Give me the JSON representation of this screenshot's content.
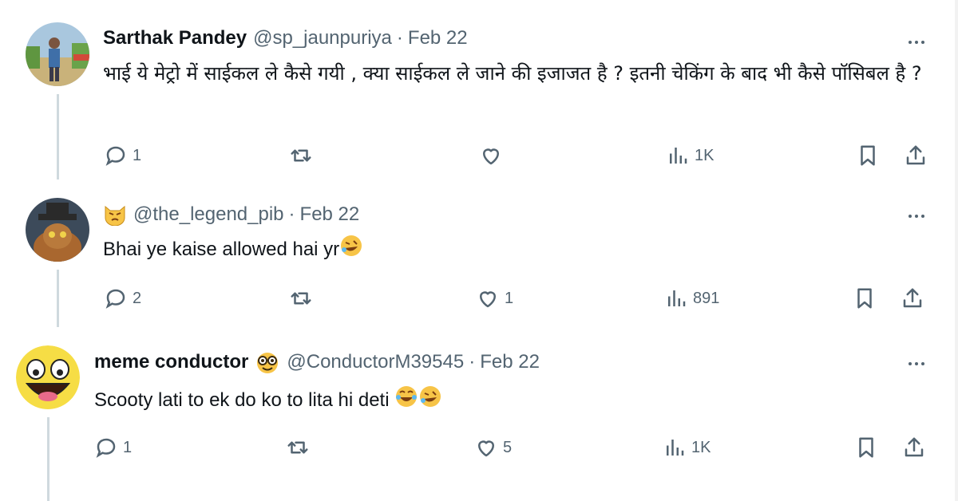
{
  "tweets": [
    {
      "name": "Sarthak Pandey",
      "handle": "@sp_jaunpuriya",
      "sep": "·",
      "date": "Feb 22",
      "text": "भाई ये मेट्रो में साईकल ले कैसे गयी , क्या साईकल ले जाने की इजाजत है ? इतनी चेकिंग के बाद भी कैसे पॉसिबल है ?",
      "replies": "1",
      "retweets": "",
      "likes": "",
      "views": "1K"
    },
    {
      "name": "",
      "handle": "@the_legend_pib",
      "sep": "·",
      "date": "Feb 22",
      "text": "Bhai ye kaise allowed hai yr",
      "replies": "2",
      "retweets": "",
      "likes": "1",
      "views": "891"
    },
    {
      "name": "meme conductor",
      "handle": "@ConductorM39545",
      "sep": "·",
      "date": "Feb 22",
      "text": "Scooty lati to ek do ko to lita hi deti",
      "replies": "1",
      "retweets": "",
      "likes": "5",
      "views": "1K"
    }
  ],
  "icons": {
    "reply": "reply-icon",
    "retweet": "retweet-icon",
    "like": "heart-icon",
    "views": "views-icon",
    "bookmark": "bookmark-icon",
    "share": "share-icon",
    "more": "more-icon"
  },
  "colors": {
    "muted": "#536471",
    "text": "#0f1419",
    "line": "#cfd9de"
  }
}
